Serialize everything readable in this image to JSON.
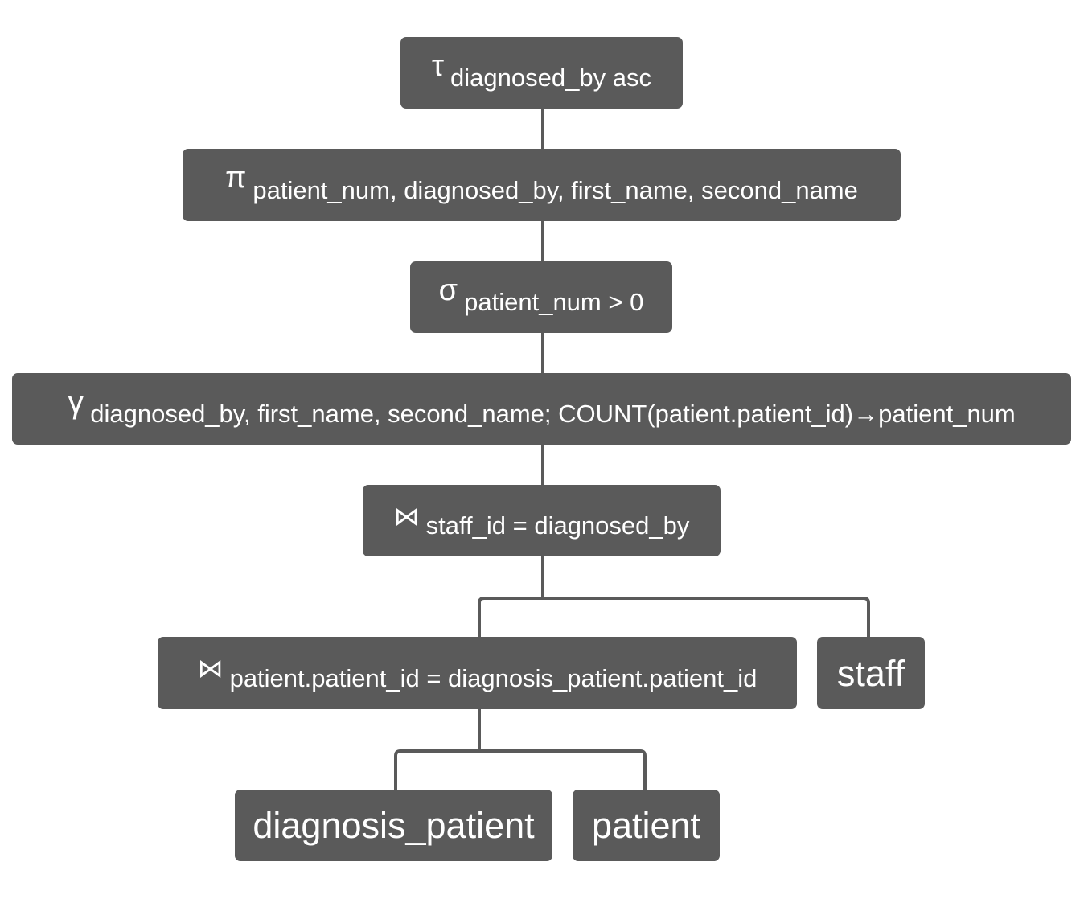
{
  "tree": {
    "sort": {
      "symbol": "τ",
      "condition": "diagnosed_by asc"
    },
    "projection": {
      "symbol": "π",
      "condition": "patient_num, diagnosed_by, first_name, second_name"
    },
    "selection": {
      "symbol": "σ",
      "condition": "patient_num > 0"
    },
    "grouping": {
      "symbol": "γ",
      "condition": "diagnosed_by, first_name, second_name; COUNT(patient.patient_id)→patient_num"
    },
    "join_staff": {
      "symbol": "⋈",
      "condition": "staff_id = diagnosed_by"
    },
    "join_patient": {
      "symbol": "⋈",
      "condition": "patient.patient_id = diagnosis_patient.patient_id"
    },
    "relations": {
      "staff": "staff",
      "diagnosis_patient": "diagnosis_patient",
      "patient": "patient"
    }
  },
  "colors": {
    "node_fill": "#5a5a5a",
    "node_text": "#ffffff",
    "connector": "#5a5a5a"
  }
}
